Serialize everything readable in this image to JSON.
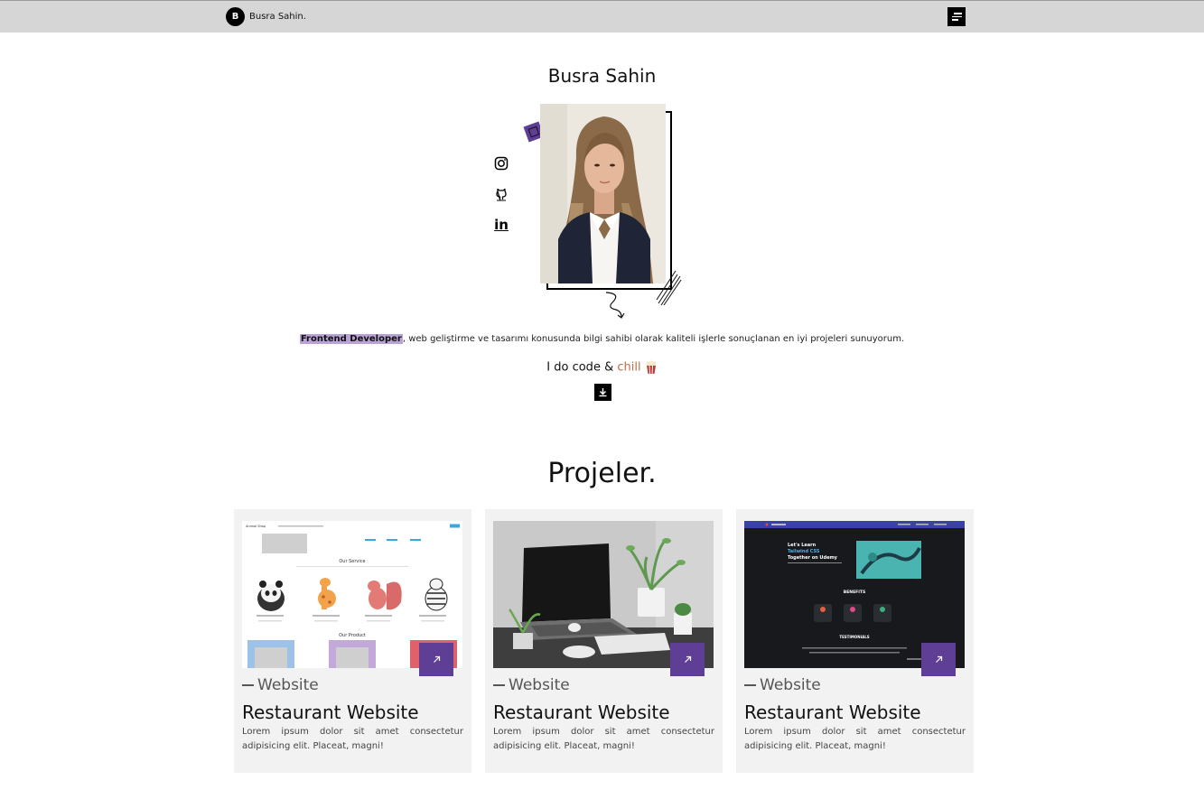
{
  "navbar": {
    "logo_letter": "B",
    "brand_name": "Busra Sahin."
  },
  "hero": {
    "name": "Busra Sahin",
    "role": "Frontend Developer",
    "about_rest": ", web geliştirme ve tasarımı konusunda bilgi sahibi olarak kaliteli işlerle sonuçlanan en iyi projeleri sunuyorum.",
    "tagline_prefix": "I do code & ",
    "tagline_chill": "chill",
    "socials": [
      "instagram-icon",
      "github-icon",
      "linkedin-icon"
    ],
    "linkedin_text": "in"
  },
  "projects": {
    "title": "Projeler.",
    "items": [
      {
        "category": "Website",
        "title": "Restaurant Website",
        "description": "Lorem ipsum dolor sit amet consectetur adipisicing elit. Placeat, magni!"
      },
      {
        "category": "Website",
        "title": "Restaurant Website",
        "description": "Lorem ipsum dolor sit amet consectetur adipisicing elit. Placeat, magni!"
      },
      {
        "category": "Website",
        "title": "Restaurant Website",
        "description": "Lorem ipsum dolor sit amet consectetur adipisicing elit. Placeat, magni!"
      }
    ],
    "thumb1": {
      "nav_logo": "Animal Shop",
      "section1": "Our Service",
      "section2": "Our Product"
    },
    "thumb3": {
      "headline": "Let's Learn",
      "headline2": "Tailwind CSS",
      "headline3": "Together on Udemy",
      "section": "BENEFITS",
      "section2": "TESTIMONIALS"
    }
  },
  "colors": {
    "accent": "#5f3e96",
    "role_highlight": "#b9a3d6",
    "navbar_bg": "#d6d6d6",
    "card_bg": "#f2f2f2"
  }
}
